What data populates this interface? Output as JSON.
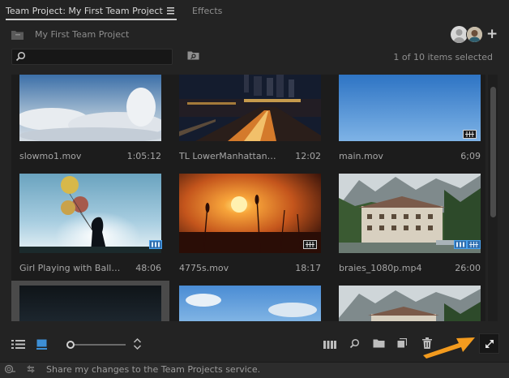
{
  "tabs": {
    "active_label": "Team Project: My First Team Project",
    "second_label": "Effects"
  },
  "header": {
    "project_name": "My First Team Project"
  },
  "search": {
    "value": "",
    "placeholder": ""
  },
  "selection_status": "1 of 10 items selected",
  "items": [
    {
      "name": "slowmo1.mov",
      "duration": "1:05:12"
    },
    {
      "name": "TL LowerManhattan05 du...",
      "duration": "12:02"
    },
    {
      "name": "main.mov",
      "duration": "6;09"
    },
    {
      "name": "Girl Playing with Ballons....",
      "duration": "48:06"
    },
    {
      "name": "4775s.mov",
      "duration": "18:17"
    },
    {
      "name": "braies_1080p.mp4",
      "duration": "26:00"
    },
    {
      "name": "",
      "duration": ""
    },
    {
      "name": "",
      "duration": ""
    },
    {
      "name": "",
      "duration": ""
    }
  ],
  "status_bar": {
    "message": "Share my changes to the Team Projects service."
  },
  "zoom_slider_value": 0.05,
  "colors": {
    "accent_orange": "#f39b1e",
    "badge_blue": "#3d8fd6",
    "active_view_blue": "#3d8fd6"
  },
  "icons": [
    "menu-icon",
    "folder-icon",
    "search-icon",
    "new-bin-icon",
    "add-user-icon",
    "list-view-icon",
    "icon-view-icon",
    "sort-icon",
    "automate-icon",
    "find-icon",
    "new-bin-button-icon",
    "new-item-icon",
    "trash-icon",
    "expand-icon",
    "cloud-icon",
    "sync-icon"
  ]
}
